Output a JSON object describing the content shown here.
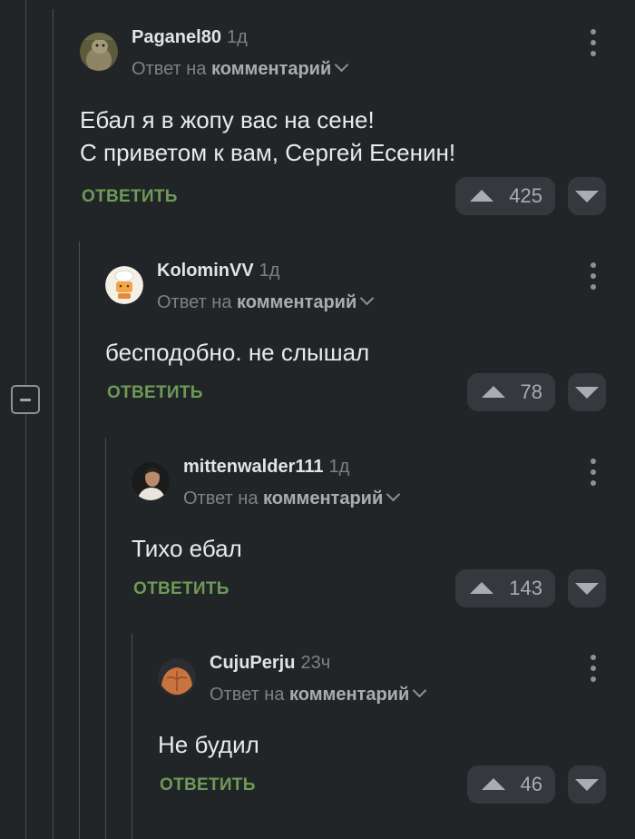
{
  "comments": [
    {
      "author": "Paganel80",
      "time": "1д",
      "reply_prefix": "Ответ на",
      "reply_target": "комментарий",
      "text": "Ебал я в жопу вас на сене!\nС приветом к вам, Сергей Есенин!",
      "reply_label": "ОТВЕТИТЬ",
      "rating": "425",
      "avatar_icon": "marmot-avatar-icon"
    },
    {
      "author": "KolominVV",
      "time": "1д",
      "reply_prefix": "Ответ на",
      "reply_target": "комментарий",
      "text": "бесподобно. не слышал",
      "reply_label": "ОТВЕТИТЬ",
      "rating": "78",
      "avatar_icon": "chef-avatar-icon"
    },
    {
      "author": "mittenwalder111",
      "time": "1д",
      "reply_prefix": "Ответ на",
      "reply_target": "комментарий",
      "text": "Тихо ебал",
      "reply_label": "ОТВЕТИТЬ",
      "rating": "143",
      "avatar_icon": "portrait-avatar-icon"
    },
    {
      "author": "CujuPerju",
      "time": "23ч",
      "reply_prefix": "Ответ на",
      "reply_target": "комментарий",
      "text": "Не будил",
      "reply_label": "ОТВЕТИТЬ",
      "rating": "46",
      "avatar_icon": "torso-avatar-icon"
    }
  ],
  "colors": {
    "background": "#222528",
    "reply_link": "#6e9a57",
    "thread_line": "#4a4e53",
    "vote_button": "#35383c"
  }
}
